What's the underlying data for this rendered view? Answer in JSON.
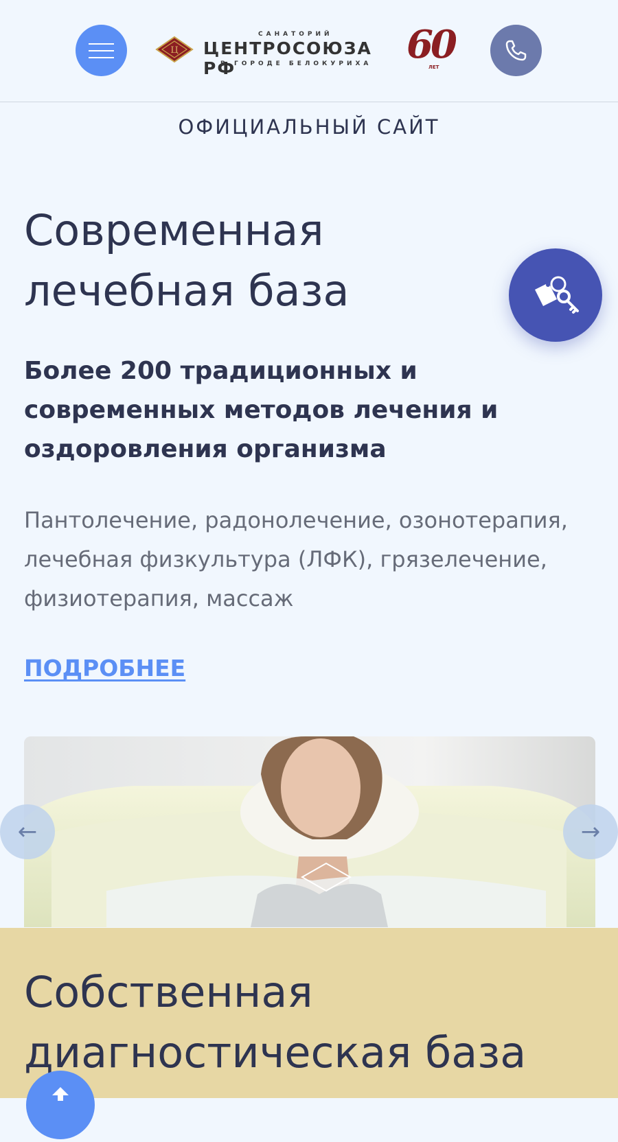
{
  "header": {
    "logo": {
      "top_text": "САНАТОРИЙ",
      "main_text": "ЦЕНТРОСОЮЗА РФ",
      "bottom_text": "В ГОРОДЕ БЕЛОКУРИХА",
      "anniversary_number": "60",
      "anniversary_label": "ЛЕТ"
    },
    "menu_icon": "hamburger-icon",
    "phone_icon": "phone-icon"
  },
  "official_site": "ОФИЦИАЛЬНЫЙ САЙТ",
  "section1": {
    "title": "Современная лечебная база",
    "subtitle": "Более 200 традиционных и современных методов лечения и оздоровления организма",
    "description": "Пантолечение, радонолечение, озонотерапия, лечебная физкультура (ЛФК), грязелечение, физиотерапия, массаж",
    "more_link": "ПОДРОБНЕЕ",
    "booking_icon": "key-icon"
  },
  "slider": {
    "prev_arrow": "←",
    "next_arrow": "→"
  },
  "section2": {
    "title": "Собственная диагностическая база"
  },
  "colors": {
    "background": "#f1f7fe",
    "accent_blue": "#5b8ff5",
    "key_button": "#4654b3",
    "phone_button": "#6c7aac",
    "section2_background": "#e7d7a4",
    "heading_text": "#2e3450",
    "body_text": "#666b78",
    "brand_red": "#8b1e22"
  }
}
